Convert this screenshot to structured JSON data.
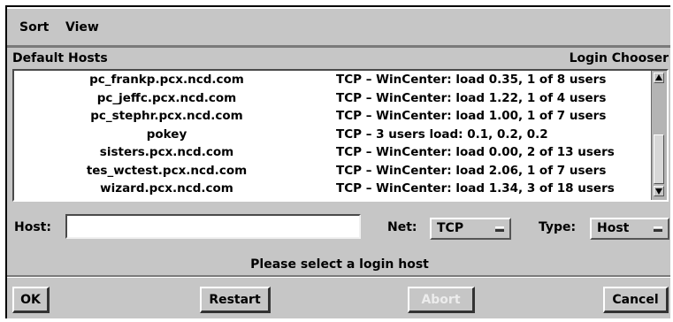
{
  "menubar": {
    "items": [
      "Sort",
      "View"
    ]
  },
  "list_header": {
    "left": "Default Hosts",
    "right": "Login Chooser"
  },
  "hosts": [
    {
      "name": "pc_frankp.pcx.ncd.com",
      "info": "TCP – WinCenter: load 0.35, 1 of 8 users"
    },
    {
      "name": "pc_jeffc.pcx.ncd.com",
      "info": "TCP – WinCenter: load 1.22, 1 of 4 users"
    },
    {
      "name": "pc_stephr.pcx.ncd.com",
      "info": "TCP – WinCenter: load 1.00, 1 of 7 users"
    },
    {
      "name": "pokey",
      "info": "TCP – 3 users  load: 0.1, 0.2, 0.2"
    },
    {
      "name": "sisters.pcx.ncd.com",
      "info": "TCP – WinCenter: load 0.00, 2 of 13 users"
    },
    {
      "name": "tes_wctest.pcx.ncd.com",
      "info": "TCP – WinCenter: load 2.06, 1 of 7 users"
    },
    {
      "name": "wizard.pcx.ncd.com",
      "info": "TCP – WinCenter: load 1.34, 3 of 18 users"
    }
  ],
  "form": {
    "host_label": "Host:",
    "host_value": "",
    "net_label": "Net:",
    "net_value": "TCP",
    "type_label": "Type:",
    "type_value": "Host"
  },
  "status": "Please select a login host",
  "buttons": {
    "ok": "OK",
    "restart": "Restart",
    "abort": "Abort",
    "cancel": "Cancel"
  },
  "icons": {
    "scroll_up": "arrow-up-icon",
    "scroll_down": "arrow-down-icon",
    "option_indicator": "option-menu-indicator-icon"
  }
}
